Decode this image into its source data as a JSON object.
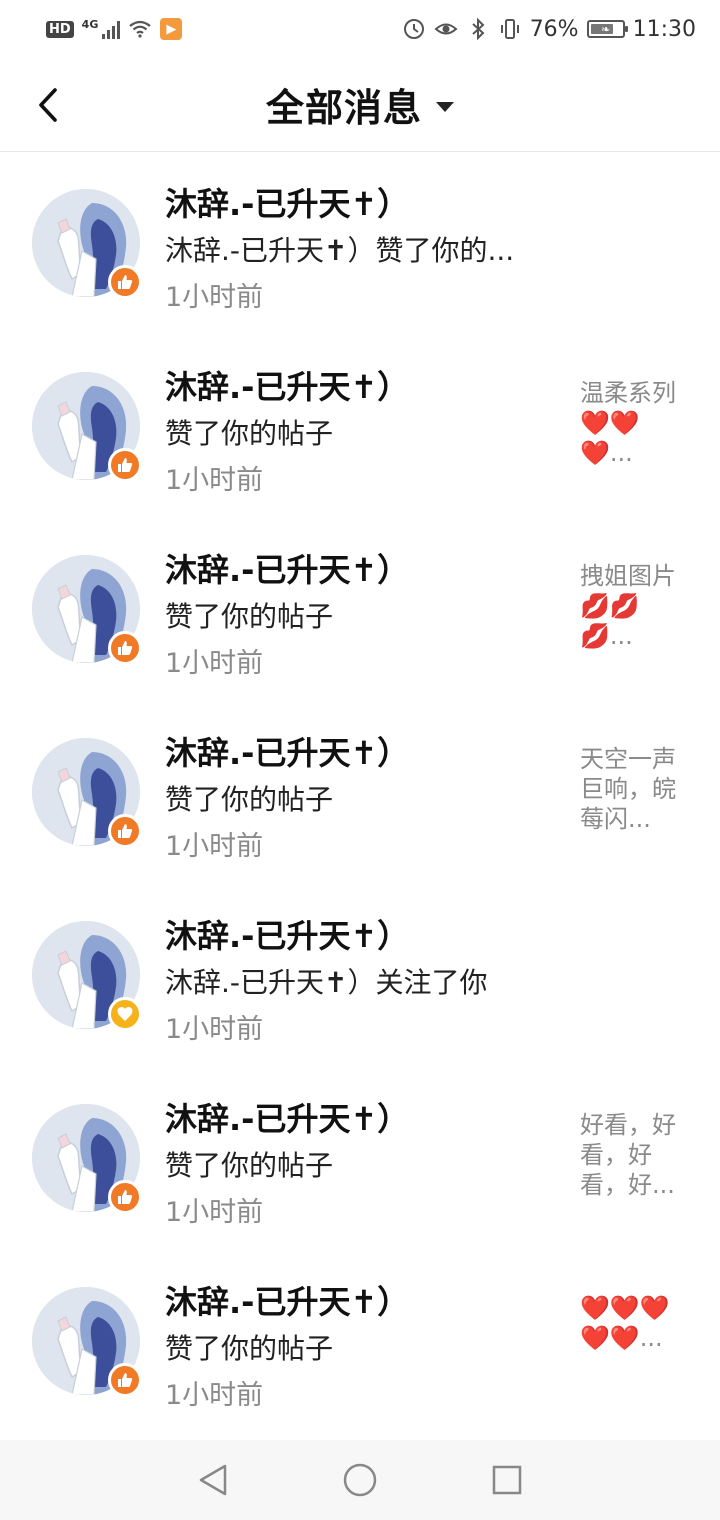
{
  "status_bar": {
    "hd": "HD",
    "network": "4G",
    "battery_percent": "76%",
    "battery_level": 0.76,
    "time": "11:30"
  },
  "header": {
    "back_icon": "chevron-left-icon",
    "title": "全部消息",
    "dropdown_icon": "caret-down-icon"
  },
  "notifications": [
    {
      "name": "沐辞.-已升天✝）",
      "action": "沐辞.-已升天✝）赞了你的...",
      "time": "1小时前",
      "badge": "like",
      "preview": ""
    },
    {
      "name": "沐辞.-已升天✝）",
      "action": "赞了你的帖子",
      "time": "1小时前",
      "badge": "like",
      "preview": "温柔系列❤️❤️❤️..."
    },
    {
      "name": "沐辞.-已升天✝）",
      "action": "赞了你的帖子",
      "time": "1小时前",
      "badge": "like",
      "preview": "拽姐图片💋💋💋..."
    },
    {
      "name": "沐辞.-已升天✝）",
      "action": "赞了你的帖子",
      "time": "1小时前",
      "badge": "like",
      "preview": "天空一声巨响，皖莓闪..."
    },
    {
      "name": "沐辞.-已升天✝）",
      "action": "沐辞.-已升天✝）关注了你",
      "time": "1小时前",
      "badge": "follow",
      "preview": ""
    },
    {
      "name": "沐辞.-已升天✝）",
      "action": "赞了你的帖子",
      "time": "1小时前",
      "badge": "like",
      "preview": "好看，好看，好看，好..."
    },
    {
      "name": "沐辞.-已升天✝）",
      "action": "赞了你的帖子",
      "time": "1小时前",
      "badge": "like",
      "preview": "❤️❤️❤️❤️❤️..."
    }
  ],
  "nav_bar": {
    "back": "triangle-back-icon",
    "home": "circle-home-icon",
    "recents": "square-recents-icon"
  },
  "colors": {
    "like_badge": "#f07a26",
    "follow_badge": "#f6b21a",
    "secondary_text": "#8a8a8a"
  }
}
